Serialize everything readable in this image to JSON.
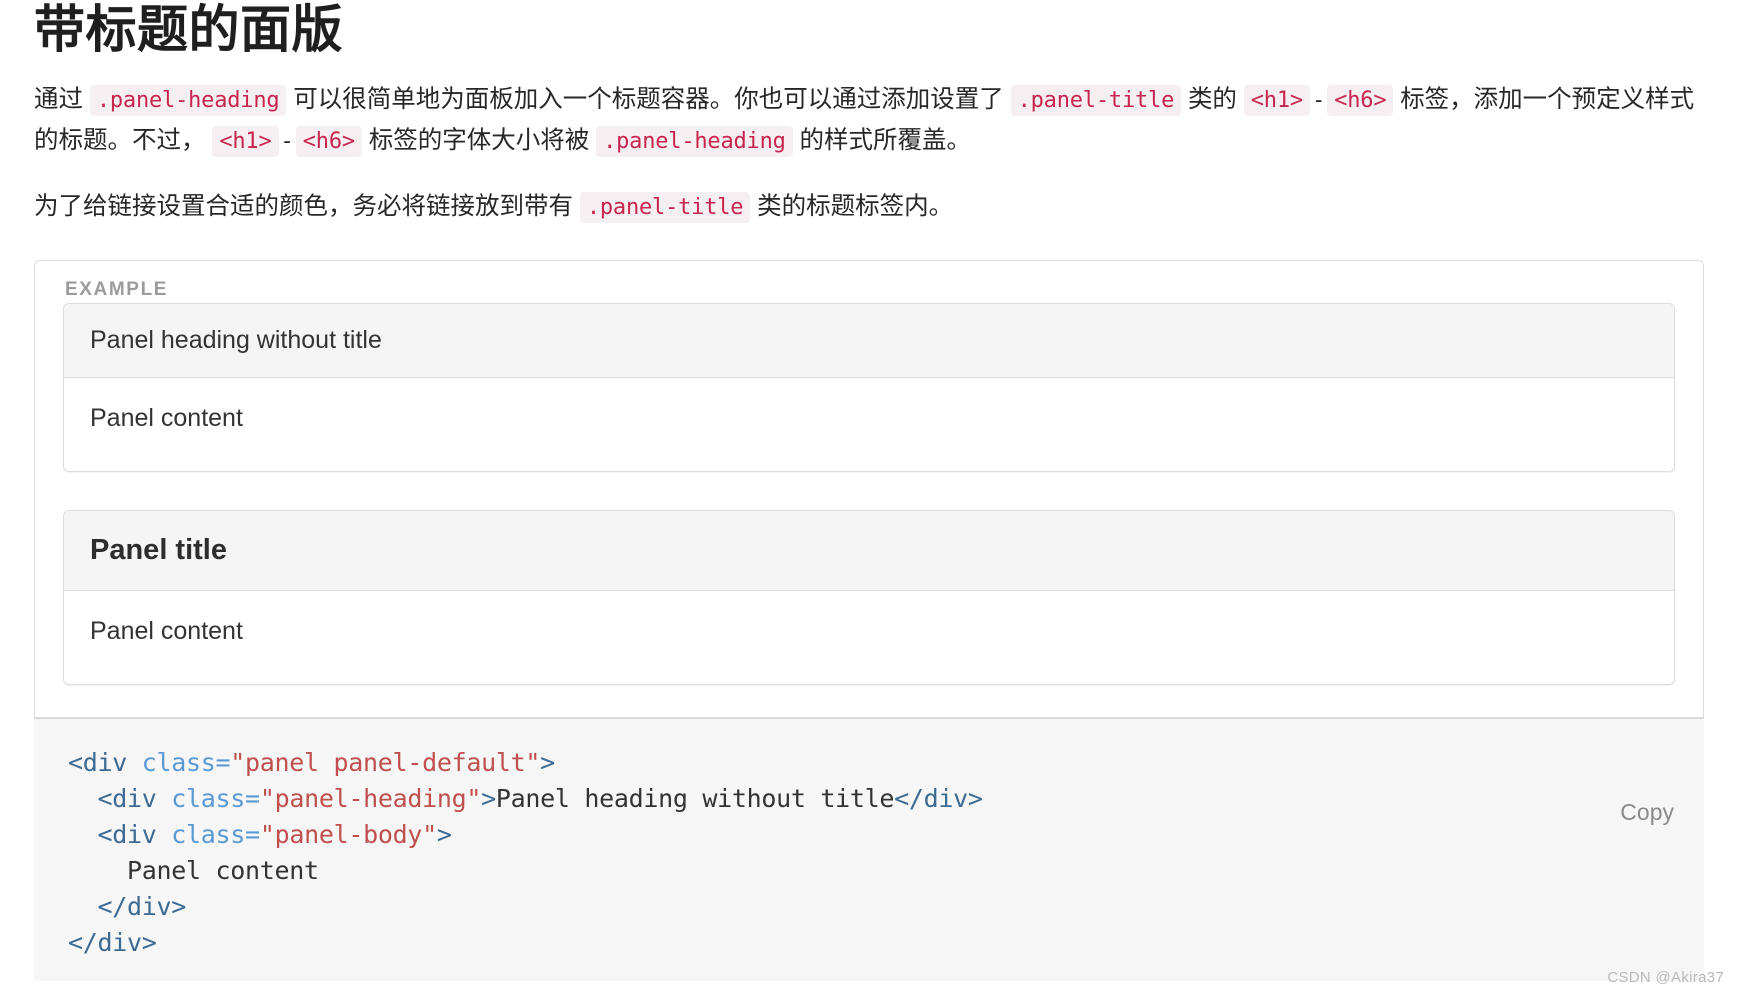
{
  "page": {
    "title": "带标题的面版"
  },
  "paragraphs": {
    "first": {
      "s1": "通过",
      "code1": ".panel-heading",
      "s2": "可以很简单地为面板加入一个标题容器。你也可以通过添加设置了",
      "code2": ".panel-title",
      "s3": "类的",
      "code3": "<h1>",
      "dash1": "-",
      "code4": "<h6>",
      "s4": "标签，添加一个预定义样式的标题。不过，",
      "code5": "<h1>",
      "dash2": "-",
      "code6": "<h6>",
      "s5": "标签的字体大小将被",
      "code7": ".panel-heading",
      "s6": "的样式所覆盖。"
    },
    "second": {
      "s1": "为了给链接设置合适的颜色，务必将链接放到带有",
      "code1": ".panel-title",
      "s2": "类的标题标签内。"
    }
  },
  "example": {
    "label": "EXAMPLE",
    "panels": [
      {
        "heading": "Panel heading without title",
        "is_title": false,
        "body": "Panel content"
      },
      {
        "heading": "Panel title",
        "is_title": true,
        "body": "Panel content"
      }
    ]
  },
  "code": {
    "copy_label": "Copy",
    "lines": [
      [
        {
          "t": "tag",
          "v": "<div "
        },
        {
          "t": "attr",
          "v": "class"
        },
        {
          "t": "eq",
          "v": "="
        },
        {
          "t": "str",
          "v": "\"panel panel-default\""
        },
        {
          "t": "tag",
          "v": ">"
        }
      ],
      [
        {
          "t": "text",
          "v": "  "
        },
        {
          "t": "tag",
          "v": "<div "
        },
        {
          "t": "attr",
          "v": "class"
        },
        {
          "t": "eq",
          "v": "="
        },
        {
          "t": "str",
          "v": "\"panel-heading\""
        },
        {
          "t": "tag",
          "v": ">"
        },
        {
          "t": "text",
          "v": "Panel heading without title"
        },
        {
          "t": "tag",
          "v": "</div>"
        }
      ],
      [
        {
          "t": "text",
          "v": "  "
        },
        {
          "t": "tag",
          "v": "<div "
        },
        {
          "t": "attr",
          "v": "class"
        },
        {
          "t": "eq",
          "v": "="
        },
        {
          "t": "str",
          "v": "\"panel-body\""
        },
        {
          "t": "tag",
          "v": ">"
        }
      ],
      [
        {
          "t": "text",
          "v": "    Panel content"
        }
      ],
      [
        {
          "t": "text",
          "v": "  "
        },
        {
          "t": "tag",
          "v": "</div>"
        }
      ],
      [
        {
          "t": "tag",
          "v": "</div>"
        }
      ]
    ]
  },
  "watermark": "CSDN @Akira37",
  "colors": {
    "inline_code_text": "#c7254e",
    "inline_code_bg": "#f6eff1",
    "panel_heading_bg": "#f5f5f5",
    "panel_border": "#dddddd",
    "code_bg": "#f6f6f7",
    "code_tag": "#3d6a92",
    "code_attr": "#5a9ad4",
    "code_string": "#c0504d"
  }
}
